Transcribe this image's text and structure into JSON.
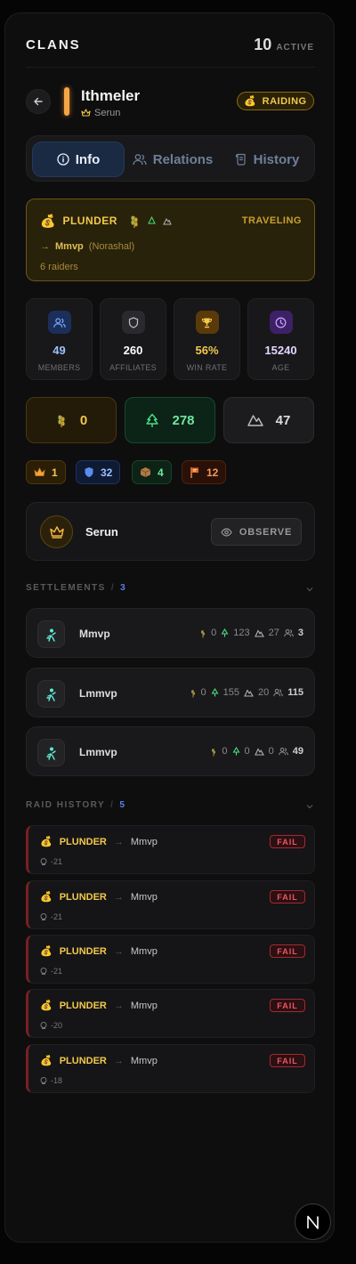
{
  "header": {
    "title": "CLANS",
    "active_count": "10",
    "active_label": "ACTIVE"
  },
  "clan": {
    "name": "Ithmeler",
    "leader": "Serun",
    "status": "RAIDING",
    "color": "#f4a545"
  },
  "tabs": [
    {
      "label": "Info",
      "icon": "info-icon",
      "active": true
    },
    {
      "label": "Relations",
      "icon": "users-icon",
      "active": false
    },
    {
      "label": "History",
      "icon": "scroll-icon",
      "active": false
    }
  ],
  "current_raid": {
    "type": "PLUNDER",
    "status": "TRAVELING",
    "target": "Mmvp",
    "target_owner": "(Norashal)",
    "raiders": "6 raiders",
    "arrow": "→"
  },
  "stats": [
    {
      "value": "49",
      "label": "MEMBERS",
      "icon": "users-icon",
      "color": "#9cc0ff"
    },
    {
      "value": "260",
      "label": "AFFILIATES",
      "icon": "shield-icon",
      "color": "#ffffff"
    },
    {
      "value": "56%",
      "label": "WIN RATE",
      "icon": "trophy-icon",
      "color": "#f2c94c"
    },
    {
      "value": "15240",
      "label": "AGE",
      "icon": "clock-icon",
      "color": "#e4d4ff"
    }
  ],
  "resources": [
    {
      "icon": "wheat-icon",
      "value": "0"
    },
    {
      "icon": "tree-icon",
      "value": "278"
    },
    {
      "icon": "mountain-icon",
      "value": "47"
    }
  ],
  "chips": [
    {
      "icon": "crown-icon",
      "value": "1"
    },
    {
      "icon": "shield-icon",
      "value": "32"
    },
    {
      "icon": "crate-icon",
      "value": "4"
    },
    {
      "icon": "banner-icon",
      "value": "12"
    }
  ],
  "leader_card": {
    "name": "Serun",
    "observe_label": "OBSERVE"
  },
  "settlements_section": {
    "title": "SETTLEMENTS",
    "slash": "/",
    "count": "3"
  },
  "settlements": [
    {
      "name": "Mmvp",
      "food": "0",
      "wood": "123",
      "stone": "27",
      "pop": "3"
    },
    {
      "name": "Lmmvp",
      "food": "0",
      "wood": "155",
      "stone": "20",
      "pop": "115"
    },
    {
      "name": "Lmmvp",
      "food": "0",
      "wood": "0",
      "stone": "0",
      "pop": "49"
    }
  ],
  "raids_section": {
    "title": "RAID HISTORY",
    "slash": "/",
    "count": "5"
  },
  "raids": [
    {
      "type": "PLUNDER",
      "arrow": "→",
      "target": "Mmvp",
      "result": "FAIL",
      "loss": "-21"
    },
    {
      "type": "PLUNDER",
      "arrow": "→",
      "target": "Mmvp",
      "result": "FAIL",
      "loss": "-21"
    },
    {
      "type": "PLUNDER",
      "arrow": "→",
      "target": "Mmvp",
      "result": "FAIL",
      "loss": "-21"
    },
    {
      "type": "PLUNDER",
      "arrow": "→",
      "target": "Mmvp",
      "result": "FAIL",
      "loss": "-20"
    },
    {
      "type": "PLUNDER",
      "arrow": "→",
      "target": "Mmvp",
      "result": "FAIL",
      "loss": "-18"
    }
  ],
  "fab": {
    "label": "N"
  }
}
